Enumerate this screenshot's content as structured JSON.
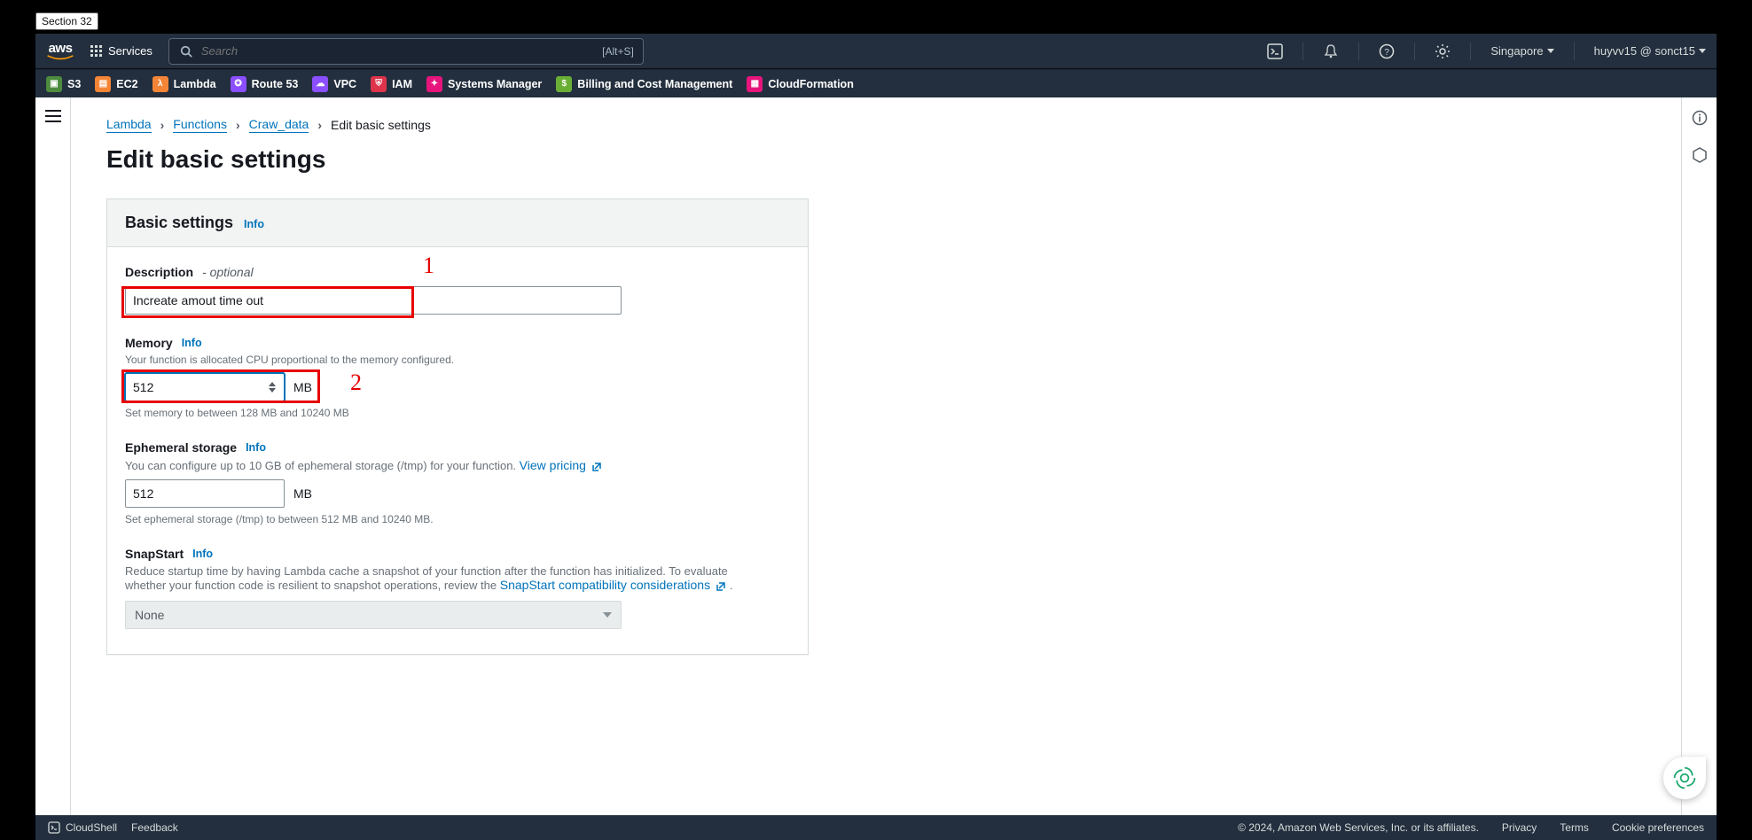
{
  "section_tag": "Section 32",
  "topbar": {
    "logo_text": "aws",
    "services_label": "Services",
    "search_placeholder": "Search",
    "search_hint": "[Alt+S]",
    "region": "Singapore",
    "account": "huyvv15 @ sonct15"
  },
  "svcbar": {
    "items": [
      {
        "label": "S3"
      },
      {
        "label": "EC2"
      },
      {
        "label": "Lambda"
      },
      {
        "label": "Route 53"
      },
      {
        "label": "VPC"
      },
      {
        "label": "IAM"
      },
      {
        "label": "Systems Manager"
      },
      {
        "label": "Billing and Cost Management"
      },
      {
        "label": "CloudFormation"
      }
    ]
  },
  "breadcrumbs": {
    "items": [
      "Lambda",
      "Functions",
      "Craw_data"
    ],
    "current": "Edit basic settings"
  },
  "page_title": "Edit basic settings",
  "panel": {
    "title": "Basic settings",
    "info": "Info"
  },
  "fields": {
    "description": {
      "label": "Description",
      "optional": " - optional",
      "value": "Increate amout time out"
    },
    "memory": {
      "label": "Memory",
      "info": "Info",
      "help": "Your function is allocated CPU proportional to the memory configured.",
      "value": "512",
      "unit": "MB",
      "hint": "Set memory to between 128 MB and 10240 MB"
    },
    "ephemeral": {
      "label": "Ephemeral storage",
      "info": "Info",
      "help_prefix": "You can configure up to 10 GB of ephemeral storage (/tmp) for your function. ",
      "pricing_link": "View pricing",
      "value": "512",
      "unit": "MB",
      "hint": "Set ephemeral storage (/tmp) to between 512 MB and 10240 MB."
    },
    "snapstart": {
      "label": "SnapStart",
      "info": "Info",
      "help_prefix": "Reduce startup time by having Lambda cache a snapshot of your function after the function has initialized. To evaluate whether your function code is resilient to snapshot operations, review the ",
      "help_link": "SnapStart compatibility considerations",
      "help_suffix": ".",
      "selected": "None"
    }
  },
  "annotations": {
    "one": "1",
    "two": "2"
  },
  "footer": {
    "cloudshell": "CloudShell",
    "feedback": "Feedback",
    "copyright": "© 2024, Amazon Web Services, Inc. or its affiliates.",
    "links": [
      "Privacy",
      "Terms",
      "Cookie preferences"
    ]
  }
}
